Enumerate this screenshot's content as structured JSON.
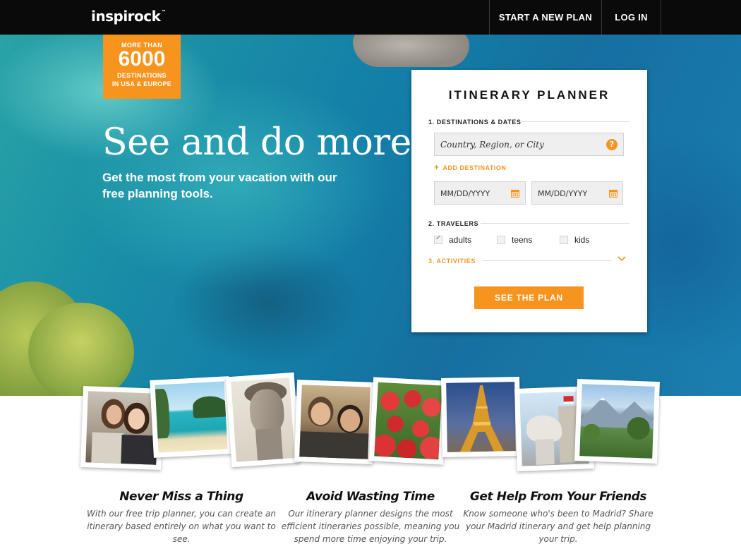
{
  "nav": {
    "logo": "inspirock",
    "logo_tm": "™",
    "start_plan": "START A NEW PLAN",
    "login": "LOG IN"
  },
  "badge": {
    "top": "MORE THAN",
    "number": "6000",
    "line1": "DESTINATIONS",
    "line2": "IN USA & EUROPE"
  },
  "hero": {
    "headline": "See and do more",
    "subline": "Get the most from your vacation with our free planning tools."
  },
  "planner": {
    "title": "ITINERARY PLANNER",
    "section1": "1. DESTINATIONS & DATES",
    "destination_placeholder": "Country, Region, or City",
    "help_icon": "?",
    "add_destination": "ADD DESTINATION",
    "date_start_placeholder": "MM/DD/YYYY",
    "date_end_placeholder": "MM/DD/YYYY",
    "section2": "2. TRAVELERS",
    "travelers": [
      {
        "label": "adults",
        "checked": true
      },
      {
        "label": "teens",
        "checked": false
      },
      {
        "label": "kids",
        "checked": false
      }
    ],
    "section3": "3. ACTIVITIES",
    "submit": "SEE THE PLAN"
  },
  "icons": {
    "help": "question-circle-icon",
    "plus": "plus-icon",
    "calendar": "calendar-icon",
    "chevron": "chevron-down-icon"
  },
  "photos": [
    {
      "subject": "two-women-photo"
    },
    {
      "subject": "beach-cove-photo"
    },
    {
      "subject": "david-statue-photo"
    },
    {
      "subject": "friends-selfie-photo"
    },
    {
      "subject": "red-tulips-photo"
    },
    {
      "subject": "eiffel-tower-photo"
    },
    {
      "subject": "horse-statue-photo"
    },
    {
      "subject": "mountain-valley-photo"
    }
  ],
  "features": [
    {
      "title": "Never Miss a Thing",
      "body": "With our free trip planner, you can create an itinerary based entirely on what you want to see."
    },
    {
      "title": "Avoid Wasting Time",
      "body": "Our itinerary planner designs the most efficient itineraries possible, meaning you spend more time enjoying your trip."
    },
    {
      "title": "Get Help From Your Friends",
      "body": "Know someone who's been to Madrid? Share your Madrid itinerary and get help planning your trip."
    }
  ],
  "colors": {
    "accent": "#f7941e",
    "nav_bg": "#0a0a0a",
    "card_bg": "#ffffff",
    "field_bg": "#efefef"
  }
}
